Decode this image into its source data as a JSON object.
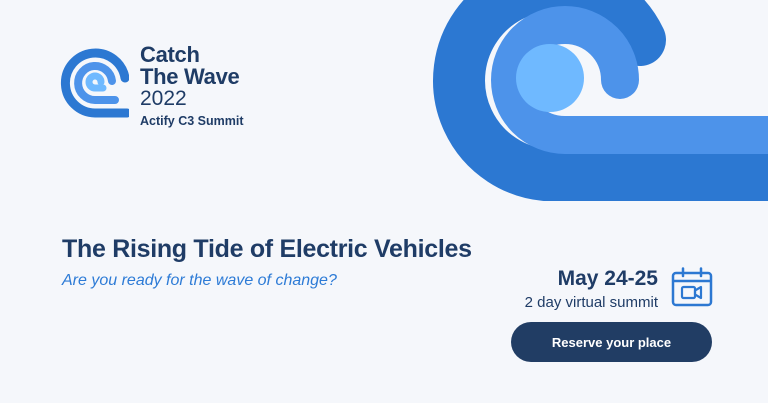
{
  "brand": {
    "line1": "Catch",
    "line2": "The Wave",
    "line3": "2022",
    "line4": "Actify C3 Summit",
    "logo_icon": "wave-icon"
  },
  "headline": "The Rising Tide of Electric Vehicles",
  "subheadline": "Are you ready for the wave of change?",
  "event": {
    "date": "May 24-25",
    "description": "2 day virtual summit",
    "calendar_icon": "calendar-video-icon"
  },
  "cta": {
    "label": "Reserve your place"
  },
  "colors": {
    "background": "#f5f7fb",
    "navy": "#213d64",
    "blue_dark": "#2c78d2",
    "blue_mid": "#4d93ea",
    "blue_light": "#6fb9ff",
    "accent_text": "#2d7bd6"
  }
}
